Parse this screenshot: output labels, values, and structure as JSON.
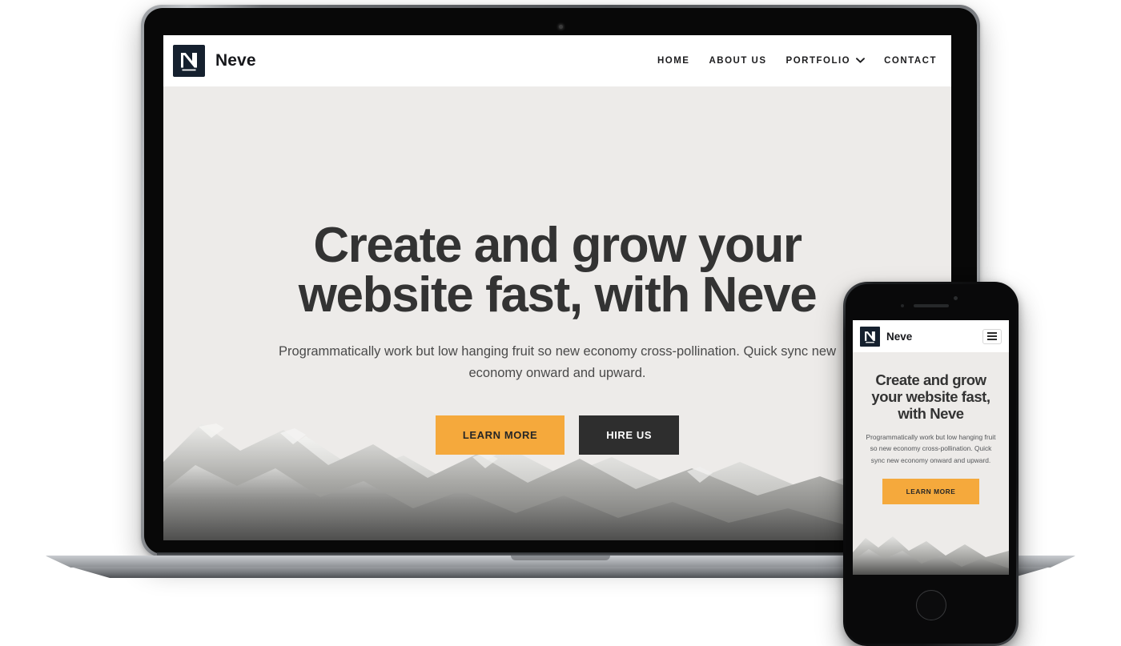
{
  "site": {
    "brand_name": "Neve",
    "logo_letter": "N",
    "nav": [
      {
        "label": "HOME",
        "has_dropdown": false
      },
      {
        "label": "ABOUT US",
        "has_dropdown": false
      },
      {
        "label": "PORTFOLIO",
        "has_dropdown": true
      },
      {
        "label": "CONTACT",
        "has_dropdown": false
      }
    ],
    "hero": {
      "title_line1": "Create and grow your",
      "title_line2": "website fast, with Neve",
      "subtitle": "Programmatically work but low hanging fruit so new economy cross-pollination. Quick sync new economy onward and upward.",
      "primary_button": "LEARN MORE",
      "secondary_button": "HIRE US"
    }
  },
  "mobile": {
    "brand_name": "Neve",
    "logo_letter": "N",
    "menu_icon": "hamburger-icon",
    "hero": {
      "title": "Create and grow your website fast, with Neve",
      "subtitle": "Programmatically work but low hanging fruit so new economy cross-pollination. Quick sync new economy onward and upward.",
      "primary_button": "LEARN MORE"
    }
  },
  "colors": {
    "accent": "#f5a93c",
    "dark_button": "#2e2e2e",
    "logo_bg": "#15202e",
    "hero_bg": "#edebe9",
    "heading": "#333333",
    "header_bg": "#ffffff"
  }
}
